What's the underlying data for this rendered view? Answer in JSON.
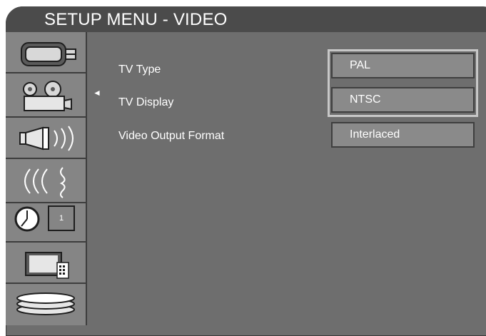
{
  "title": "SETUP MENU - VIDEO",
  "sidebar": {
    "items": [
      {
        "icon": "camcorder-icon"
      },
      {
        "icon": "film-camera-icon"
      },
      {
        "icon": "speaker-icon"
      },
      {
        "icon": "caption-sound-icon"
      },
      {
        "icon": "clock-timer-icon",
        "timer_value": "1"
      },
      {
        "icon": "tv-remote-icon"
      },
      {
        "icon": "disc-stack-icon"
      }
    ]
  },
  "settings": {
    "pointer": "◄",
    "rows": [
      {
        "label": "TV Type",
        "value": "PAL"
      },
      {
        "label": "TV Display",
        "value": "NTSC"
      },
      {
        "label": "Video Output Format",
        "value": "Interlaced"
      }
    ]
  },
  "colors": {
    "background": "#6e6e6e",
    "title_bar": "#4b4b4b",
    "option_box": "#8a8a8a",
    "focus_frame": "#c7c7c7"
  }
}
